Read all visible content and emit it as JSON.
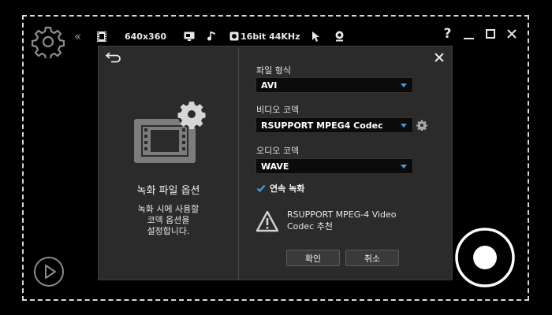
{
  "topbar": {
    "resolution": "640x360",
    "audio": "16bit 44KHz"
  },
  "dialog": {
    "left": {
      "title": "녹화 파일 옵션",
      "desc_line1": "녹화 시에 사용할",
      "desc_line2": "코덱 옵션을",
      "desc_line3": "설정합니다."
    },
    "file_format": {
      "label": "파일 형식",
      "value": "AVI"
    },
    "video_codec": {
      "label": "비디오 코덱",
      "value": "RSUPPORT MPEG4 Codec"
    },
    "audio_codec": {
      "label": "오디오 코덱",
      "value": "WAVE"
    },
    "continuous_record": {
      "label": "연속 녹화",
      "checked": true
    },
    "warning": {
      "line1": "RSUPPORT MPEG-4 Video",
      "line2": "Codec 추천"
    },
    "ok_label": "확인",
    "cancel_label": "취소"
  },
  "colors": {
    "accent": "#3fa0e8",
    "background": "#000000",
    "dialog_bg": "#2b2b2b"
  },
  "icons": [
    "gear-icon",
    "collapse-icon",
    "film-icon",
    "monitor-icon",
    "music-note-icon",
    "audio-device-icon",
    "cursor-icon",
    "webcam-icon",
    "help-icon",
    "minimize-icon",
    "maximize-icon",
    "close-icon",
    "back-icon",
    "video-settings-icon",
    "warning-icon",
    "checkmark-icon",
    "play-icon",
    "record-icon"
  ]
}
